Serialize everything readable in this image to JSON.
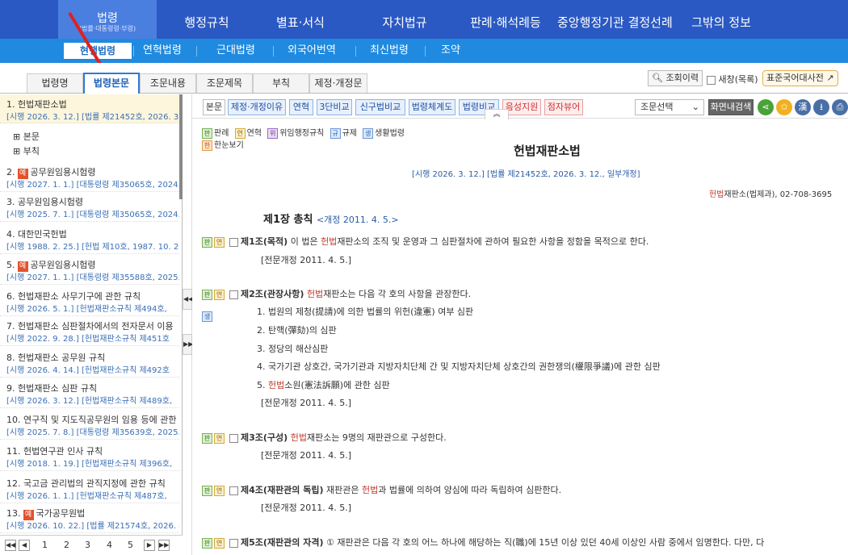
{
  "top_nav": {
    "active": {
      "label": "법령",
      "sub": "(법률·대통령령·부령)"
    },
    "items": [
      "행정규칙",
      "별표·서식",
      "자치법규",
      "판례·해석례등",
      "중앙행정기관 결정선례",
      "그밖의 정보"
    ]
  },
  "sub_nav": {
    "active": "현행법령",
    "items": [
      "연혁법령",
      "근대법령",
      "외국어번역",
      "최신법령",
      "조약"
    ]
  },
  "left_tabs": [
    "법령명",
    "법령본문",
    "조문내용",
    "조문제목",
    "부칙",
    "제정·개정문"
  ],
  "right_controls": {
    "history": "조회이력",
    "new_window": "새창(목록)",
    "dictionary": "표준국어대사전"
  },
  "law_list": [
    {
      "title": "1.  헌법재판소법",
      "sub": "[시행 2026. 3. 12.] [법률 제21452호, 2026. 3.",
      "badge": ""
    },
    {
      "title": "공무원임용시험령",
      "num": "2.",
      "sub": "[시행 2027. 1. 1.] [대통령령 제35065호, 2024.",
      "badge": "예"
    },
    {
      "title": "3.  공무원임용시험령",
      "sub": "[시행 2025. 7. 1.] [대통령령 제35065호, 2024.",
      "badge": ""
    },
    {
      "title": "4.  대한민국헌법",
      "sub": "[시행 1988. 2. 25.] [헌법 제10호, 1987. 10. 29.",
      "badge": ""
    },
    {
      "title": "공무원임용시험령",
      "num": "5.",
      "sub": "[시행 2027. 1. 1.] [대통령령 제35588호, 2025.",
      "badge": "예"
    },
    {
      "title": "6.  헌법재판소 사무기구에 관한 규칙",
      "sub": "[시행 2026. 5. 1.] [헌법재판소규칙 제494호,",
      "badge": ""
    },
    {
      "title": "7.  헌법재판소 심판절차에서의 전자문서 이용",
      "sub": "[시행 2022. 9. 28.] [헌법재판소규칙 제451호",
      "badge": ""
    },
    {
      "title": "8.  헌법재판소 공무원 규칙",
      "sub": "[시행 2026. 4. 14.] [헌법재판소규칙 제492호",
      "badge": ""
    },
    {
      "title": "9.  헌법재판소 심판 규칙",
      "sub": "[시행 2026. 3. 12.] [헌법재판소규칙 제489호,",
      "badge": ""
    },
    {
      "title": "10.  연구직 및 지도직공무원의 임용 등에 관한",
      "sub": "[시행 2025. 7. 8.] [대통령령 제35639호, 2025.",
      "badge": ""
    },
    {
      "title": "11.  헌법연구관 인사 규칙",
      "sub": "[시행 2018. 1. 19.] [헌법재판소규칙 제396호,",
      "badge": ""
    },
    {
      "title": "12.  국고금 관리법의 관직지정에 관한 규칙",
      "sub": "[시행 2026. 1. 1.] [헌법재판소규칙 제487호,",
      "badge": ""
    },
    {
      "title": "국가공무원법",
      "num": "13.",
      "sub": "[시행 2026. 10. 22.] [법률 제21574호, 2026. 4.",
      "badge": "예"
    }
  ],
  "tree": [
    "⊞ 본문",
    "⊞ 부칙"
  ],
  "pager": [
    "1",
    "2",
    "3",
    "4",
    "5"
  ],
  "toolbar": {
    "buttons": [
      "본문",
      "제정·개정이유",
      "연혁",
      "3단비교",
      "신구법비교",
      "법령체계도",
      "법령비교"
    ],
    "red_buttons": [
      "음성지원",
      "점자뷰어"
    ],
    "select": "조문선택",
    "search": "화면내검색",
    "hanja": "漢"
  },
  "legend": {
    "items": [
      "판례",
      "연혁",
      "위임행정규칙",
      "규제",
      "생활법령"
    ],
    "oneview": "한눈보기"
  },
  "doc": {
    "title": "헌법재판소법",
    "enforce": "[시행 2026. 3. 12.] [법률 제21452호, 2026. 3. 12., 일부개정]",
    "contact_red": "헌법",
    "contact": "재판소(법제과), 02-708-3695",
    "chapter": "제1장 총칙",
    "chapter_note": "<개정 2011. 4. 5.>",
    "amend_note": "[전문개정 2011. 4. 5.]",
    "a1_head": "제1조(목적)",
    "a1_pre": "이 법은",
    "a1_red": "헌법",
    "a1_post": "재판소의 조직 및 운영과 그 심판절차에 관하여 필요한 사항을 정함을 목적으로 한다.",
    "a2_head": "제2조(관장사항)",
    "a2_red": "헌법",
    "a2_post": "재판소는 다음 각 호의 사항을 관장한다.",
    "a2_items": [
      "1. 법원의 제청(提請)에 의한 법률의 위헌(違憲) 여부 심판",
      "2. 탄핵(彈劾)의 심판",
      "3. 정당의 해산심판",
      "4. 국가기관 상호간, 국가기관과 지방자치단체 간 및 지방자치단체 상호간의 권한쟁의(權限爭議)에 관한 심판"
    ],
    "a2_item5_pre": "5.",
    "a2_item5_red": "헌법",
    "a2_item5_post": "소원(憲法訴願)에 관한 심판",
    "a3_head": "제3조(구성)",
    "a3_red": "헌법",
    "a3_post": "재판소는 9명의 재판관으로 구성한다.",
    "a4_head": "제4조(재판관의 독립)",
    "a4_pre": "재판관은",
    "a4_red": "헌법",
    "a4_post": "과 법률에 의하여 양심에 따라 독립하여 심판한다.",
    "a5_head": "제5조(재판관의 자격)",
    "a5_text": "① 재판관은 다음 각 호의 어느 하나에 해당하는 직(職)에 15년 이상 있던 40세 이상인 사람 중에서 임명한다. 다만, 다"
  },
  "icons": {
    "pan": "판",
    "yeon": "연",
    "saeng": "생",
    "wi": "위",
    "gyu": "규",
    "han": "한"
  },
  "colors": {
    "top_nav": "#2b59c3",
    "sub_nav": "#1f8ae0",
    "accent_red": "#c0392b",
    "link_blue": "#2a5ca8"
  }
}
